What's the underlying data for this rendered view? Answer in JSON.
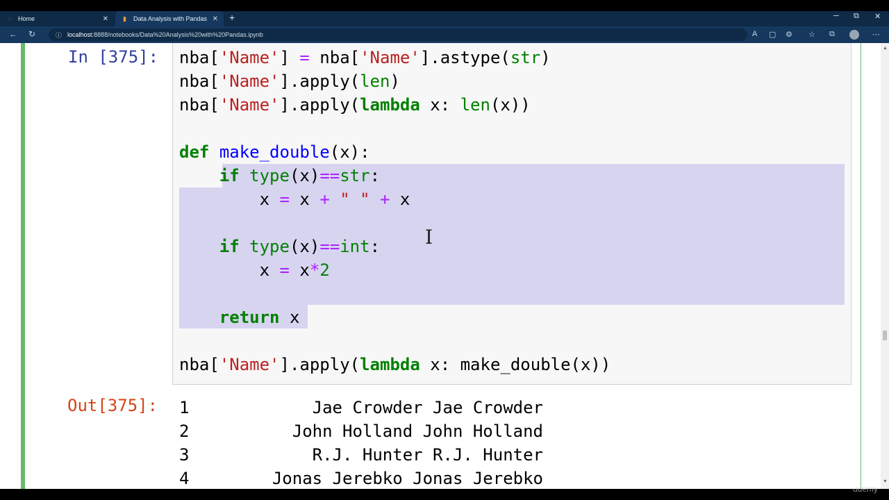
{
  "browser": {
    "tabs": [
      {
        "label": "Home",
        "icon": "jupyter-icon",
        "active": false
      },
      {
        "label": "Data Analysis with Pandas - Jupy",
        "icon": "notebook-icon",
        "active": true
      }
    ],
    "url_host": "localhost",
    "url_rest": ":8888/notebooks/Data%20Analysis%20with%20Pandas.ipynb"
  },
  "cell": {
    "in_prompt": "In [375]:",
    "out_prompt": "Out[375]:",
    "code": {
      "line1": [
        "nba[",
        "'Name'",
        "] ",
        "=",
        " nba[",
        "'Name'",
        "].astype(",
        "str",
        ")"
      ],
      "line2": [
        "nba[",
        "'Name'",
        "].apply(",
        "len",
        ")"
      ],
      "line3": [
        "nba[",
        "'Name'",
        "].apply(",
        "lambda",
        " x: ",
        "len",
        "(x))"
      ],
      "line5": [
        "def",
        " ",
        "make_double",
        "(x):"
      ],
      "line6": [
        "    ",
        "if",
        " ",
        "type",
        "(x)",
        "==",
        "str",
        ":"
      ],
      "line7": [
        "        x ",
        "=",
        " x ",
        "+",
        " ",
        "\" \"",
        " ",
        "+",
        " x"
      ],
      "line9": [
        "    ",
        "if",
        " ",
        "type",
        "(x)",
        "==",
        "int",
        ":"
      ],
      "line10": [
        "        x ",
        "=",
        " x",
        "*",
        "2"
      ],
      "line12": [
        "    ",
        "return",
        " x"
      ],
      "line14": [
        "nba[",
        "'Name'",
        "].apply(",
        "lambda",
        " x: make_double(x))"
      ]
    },
    "output_rows": [
      {
        "index": "1",
        "value": "Jae Crowder Jae Crowder"
      },
      {
        "index": "2",
        "value": "John Holland John Holland"
      },
      {
        "index": "3",
        "value": "R.J. Hunter R.J. Hunter"
      },
      {
        "index": "4",
        "value": "Jonas Jerebko Jonas Jerebko"
      }
    ]
  },
  "watermark": "udemy"
}
